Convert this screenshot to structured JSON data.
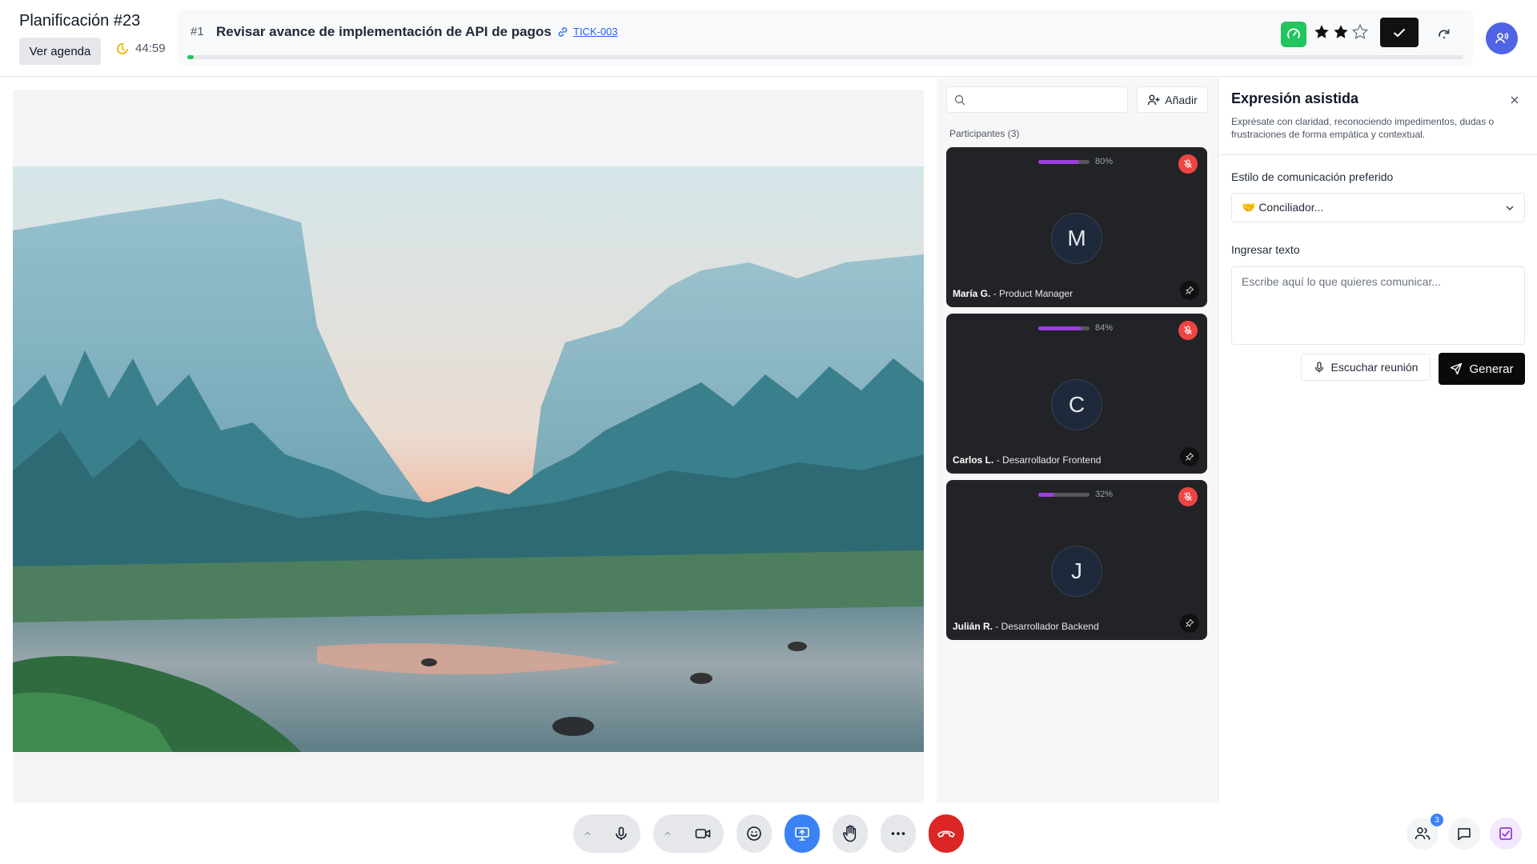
{
  "header": {
    "meeting_title": "Planificación #23",
    "agenda_button": "Ver agenda",
    "timer": "44:59",
    "task_number": "#1",
    "task_title": "Revisar avance de implementación de API de pagos",
    "ticket_link": "TICK-003",
    "task_progress_pct": 0.5,
    "rating": {
      "filled": 2,
      "total": 3
    }
  },
  "participants": {
    "search_placeholder": "",
    "add_button": "Añadir",
    "heading": "Participantes (3)",
    "list": [
      {
        "initial": "M",
        "name": "María G.",
        "role": " - Product Manager",
        "level_pct": "80%",
        "level": 80
      },
      {
        "initial": "C",
        "name": "Carlos L.",
        "role": " - Desarrollador Frontend",
        "level_pct": "84%",
        "level": 84
      },
      {
        "initial": "J",
        "name": "Julián R.",
        "role": " - Desarrollador Backend",
        "level_pct": "32%",
        "level": 32
      }
    ]
  },
  "assist": {
    "title": "Expresión asistida",
    "description": "Exprésate con claridad, reconociendo impedimentos, dudas o frustraciones de forma empática y contextual.",
    "style_label": "Estilo de comunicación preferido",
    "style_value": "🤝 Conciliador...",
    "text_label": "Ingresar texto",
    "text_placeholder": "Escribe aquí lo que quieres comunicar...",
    "listen_button": "Escuchar reunión",
    "generate_button": "Generar"
  },
  "toolbar": {
    "people_count": "3",
    "share_active_color": "#3b82f6",
    "hangup_color": "#dc2626"
  },
  "icons": [
    "timer-icon",
    "link-icon",
    "gauge-icon",
    "star-icon",
    "check-icon",
    "skip-icon",
    "user-voice-icon",
    "search-icon",
    "user-plus-icon",
    "mic-off-icon",
    "pin-icon",
    "close-icon",
    "chevron-down-icon",
    "mic-icon",
    "send-icon",
    "camera-icon",
    "emoji-icon",
    "screen-share-icon",
    "hand-icon",
    "more-icon",
    "phone-hangup-icon",
    "people-icon",
    "chat-icon",
    "notes-icon"
  ]
}
